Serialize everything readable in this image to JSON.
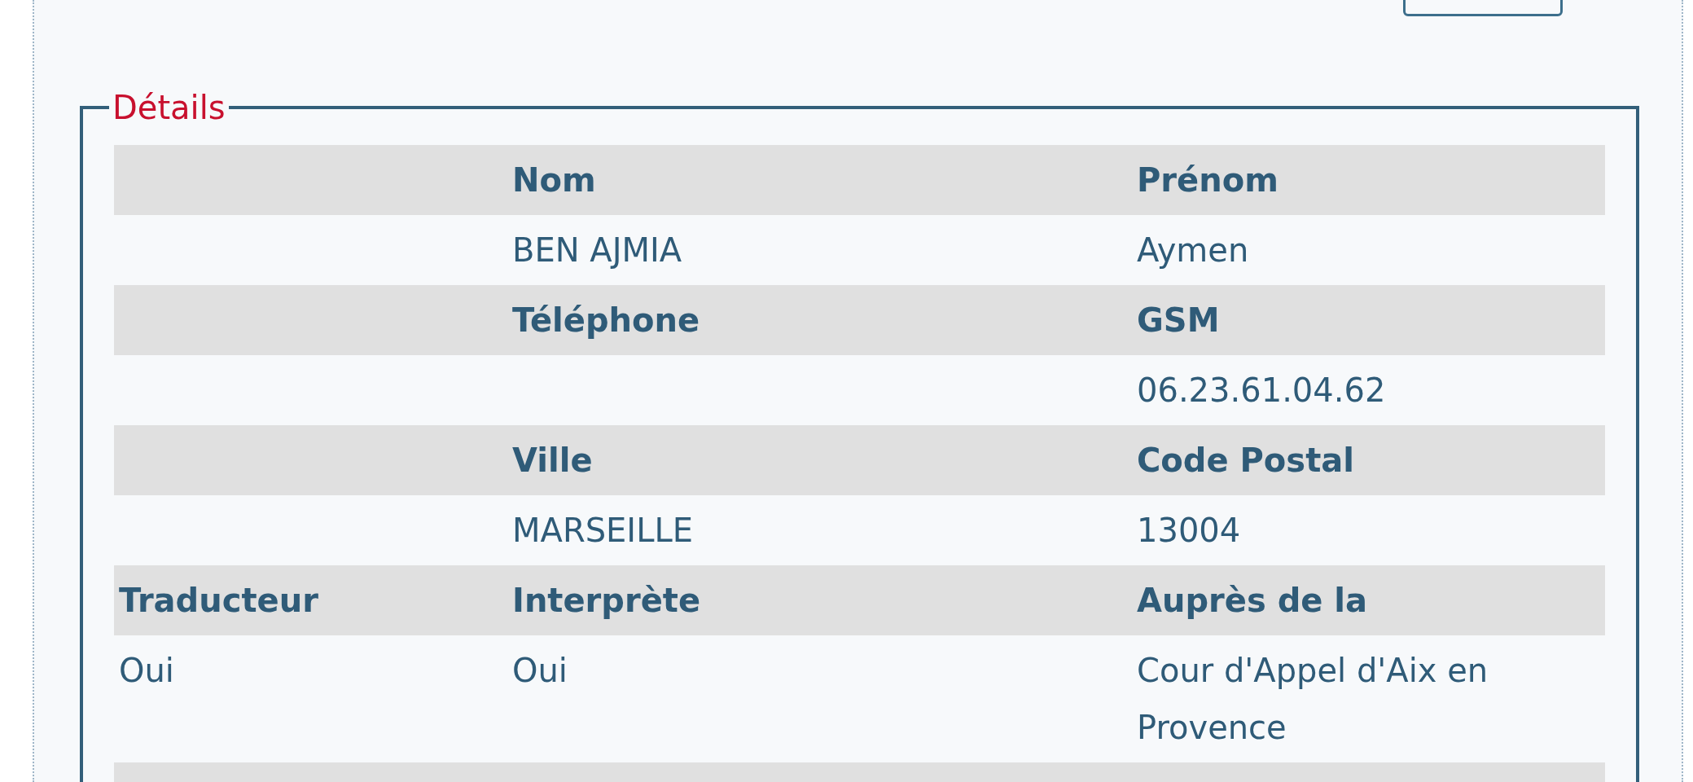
{
  "fieldset": {
    "legend": "Détails"
  },
  "rows": [
    {
      "kind": "header",
      "cells": [
        null,
        "Nom",
        "Prénom"
      ]
    },
    {
      "kind": "data",
      "cells": [
        null,
        "BEN AJMIA",
        "Aymen"
      ]
    },
    {
      "kind": "header",
      "cells": [
        null,
        "Téléphone",
        "GSM"
      ]
    },
    {
      "kind": "data",
      "cells": [
        null,
        null,
        "06.23.61.04.62"
      ]
    },
    {
      "kind": "header",
      "cells": [
        null,
        "Ville",
        "Code Postal"
      ]
    },
    {
      "kind": "data",
      "cells": [
        null,
        "MARSEILLE",
        "13004"
      ]
    },
    {
      "kind": "header",
      "cells": [
        "Traducteur",
        "Interprète",
        "Auprès de la"
      ]
    },
    {
      "kind": "data",
      "cells": [
        "Oui",
        "Oui",
        "Cour d'Appel d'Aix en Provence"
      ]
    },
    {
      "kind": "header",
      "cells": [
        null,
        null,
        null
      ]
    }
  ]
}
